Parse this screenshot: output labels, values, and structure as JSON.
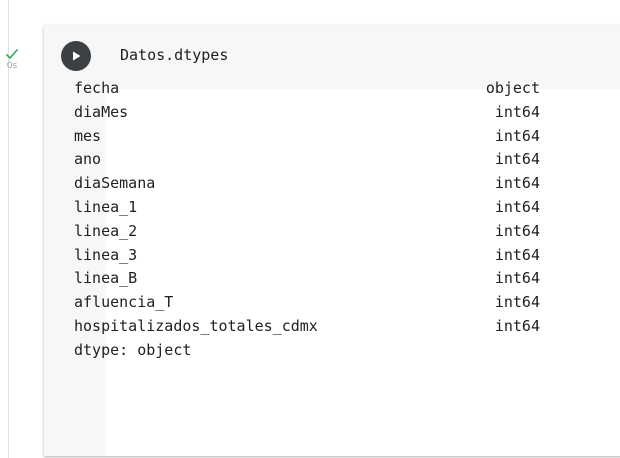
{
  "status": {
    "icon": "check-icon",
    "duration": "0s",
    "color": "#34a853"
  },
  "cell": {
    "code": "Datos.dtypes",
    "run_icon": "play-icon",
    "output": {
      "rows": [
        {
          "column": "fecha",
          "dtype": "object"
        },
        {
          "column": "diaMes",
          "dtype": "int64"
        },
        {
          "column": "mes",
          "dtype": "int64"
        },
        {
          "column": "ano",
          "dtype": "int64"
        },
        {
          "column": "diaSemana",
          "dtype": "int64"
        },
        {
          "column": "linea_1",
          "dtype": "int64"
        },
        {
          "column": "linea_2",
          "dtype": "int64"
        },
        {
          "column": "linea_3",
          "dtype": "int64"
        },
        {
          "column": "linea_B",
          "dtype": "int64"
        },
        {
          "column": "afluencia_T",
          "dtype": "int64"
        },
        {
          "column": "hospitalizados_totales_cdmx",
          "dtype": "int64"
        }
      ],
      "footer": "dtype: object"
    }
  }
}
